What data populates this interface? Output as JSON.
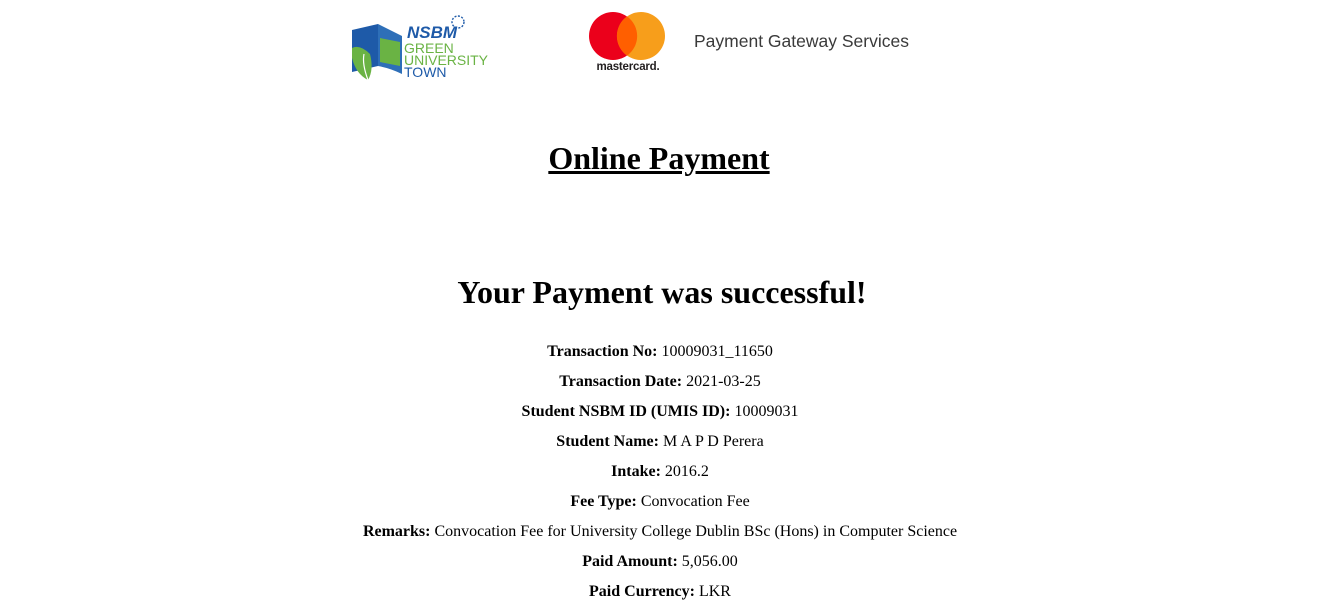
{
  "header": {
    "nsbm_logo": {
      "brand": "NSBM",
      "lines": [
        "GREEN",
        "UNIVERSITY",
        "TOWN"
      ]
    },
    "mastercard_logo": {
      "wordmark": "mastercard."
    },
    "service_text": "Payment Gateway Services"
  },
  "page_title": "Online Payment",
  "success_message": "Your Payment was successful!",
  "details": [
    {
      "label": "Transaction No:",
      "value": "10009031_11650"
    },
    {
      "label": "Transaction Date:",
      "value": "2021-03-25"
    },
    {
      "label": "Student NSBM ID (UMIS ID):",
      "value": "10009031"
    },
    {
      "label": "Student Name:",
      "value": "M A P D Perera"
    },
    {
      "label": "Intake:",
      "value": "2016.2"
    },
    {
      "label": "Fee Type:",
      "value": "Convocation Fee"
    },
    {
      "label": "Remarks:",
      "value": "Convocation Fee for University College Dublin BSc (Hons) in Computer Science"
    },
    {
      "label": "Paid Amount:",
      "value": "5,056.00"
    },
    {
      "label": "Paid Currency:",
      "value": "LKR"
    }
  ],
  "colors": {
    "nsbm_blue": "#1e5aa8",
    "nsbm_green": "#6ab344",
    "mc_red": "#eb001b",
    "mc_yellow": "#f79e1b",
    "mc_overlap": "#ff5f00"
  }
}
